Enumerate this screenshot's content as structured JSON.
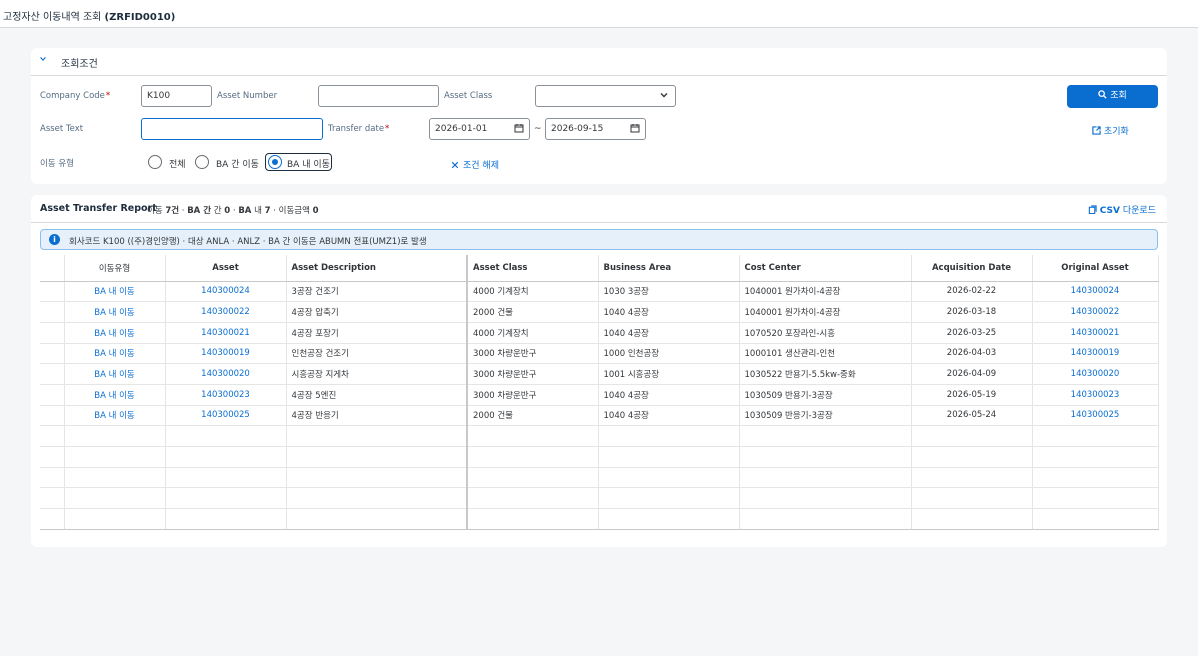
{
  "app": {
    "title_prefix": "고정자산 이동내역 조회 ",
    "title_code": "(ZRFID0010)"
  },
  "filter": {
    "section_title": "조회조건",
    "company_code_label": "Company Code",
    "company_code_value": "K100",
    "asset_number_label": "Asset Number",
    "asset_number_value": "",
    "asset_class_label": "Asset Class",
    "asset_class_value": "",
    "asset_text_label": "Asset Text",
    "asset_text_value": "",
    "transfer_date_label": "Transfer date",
    "date_from": "2026-01-01",
    "date_sep": "~",
    "date_to": "2026-09-15",
    "move_type_label": "이동 유형",
    "radio_all": "전체",
    "radio_between_ba": "BA 간 이동",
    "radio_within_ba": "BA 내 이동",
    "selected_radio": "BA 내 이동",
    "clear_label": "조건 해제",
    "search_label": "조회",
    "reset_label": "초기화"
  },
  "report": {
    "title": "Asset Transfer Report",
    "summary": {
      "count_label": "이동",
      "count_value": "7건",
      "between_label": "BA 간",
      "between_value": "0",
      "within_label": "BA 내",
      "within_value": "7",
      "amount_label": "이동금액",
      "amount_value": "0"
    },
    "csv_label": "CSV",
    "csv_suffix": "다운로드",
    "info_text": "회사코드 K100 ((주)경인양행) · 대상 ANLA · ANLZ · BA 간 이동은 ABUMN 전표(UMZ1)로 발생",
    "columns": [
      "이동유형",
      "Asset",
      "Asset Description",
      "Asset Class",
      "Business Area",
      "Cost Center",
      "Acquisition Date",
      "Original Asset"
    ],
    "rows": [
      [
        "BA 내 이동",
        "140300024",
        "3공장 건조기",
        "4000 기계장치",
        "1030 3공장",
        "1040001 원가차이-4공장",
        "2026-02-22",
        "140300024"
      ],
      [
        "BA 내 이동",
        "140300022",
        "4공장 압축기",
        "2000 건물",
        "1040 4공장",
        "1040001 원가차이-4공장",
        "2026-03-18",
        "140300022"
      ],
      [
        "BA 내 이동",
        "140300021",
        "4공장 포장기",
        "4000 기계장치",
        "1040 4공장",
        "1070520 포장라인-시흥",
        "2026-03-25",
        "140300021"
      ],
      [
        "BA 내 이동",
        "140300019",
        "인천공장 건조기",
        "3000 차량운반구",
        "1000 인천공장",
        "1000101 생산관리-인천",
        "2026-04-03",
        "140300019"
      ],
      [
        "BA 내 이동",
        "140300020",
        "시흥공장 지게차",
        "3000 차량운반구",
        "1001 시흥공장",
        "1030522 반용기-5.5kw-중화",
        "2026-04-09",
        "140300020"
      ],
      [
        "BA 내 이동",
        "140300023",
        "4공장 5엔진",
        "3000 차량운반구",
        "1040 4공장",
        "1030509 반용기-3공장",
        "2026-05-19",
        "140300023"
      ],
      [
        "BA 내 이동",
        "140300025",
        "4공장 반응기",
        "2000 건물",
        "1040 4공장",
        "1030509 반응기-3공장",
        "2026-05-24",
        "140300025"
      ]
    ],
    "empty_rows": 5
  }
}
